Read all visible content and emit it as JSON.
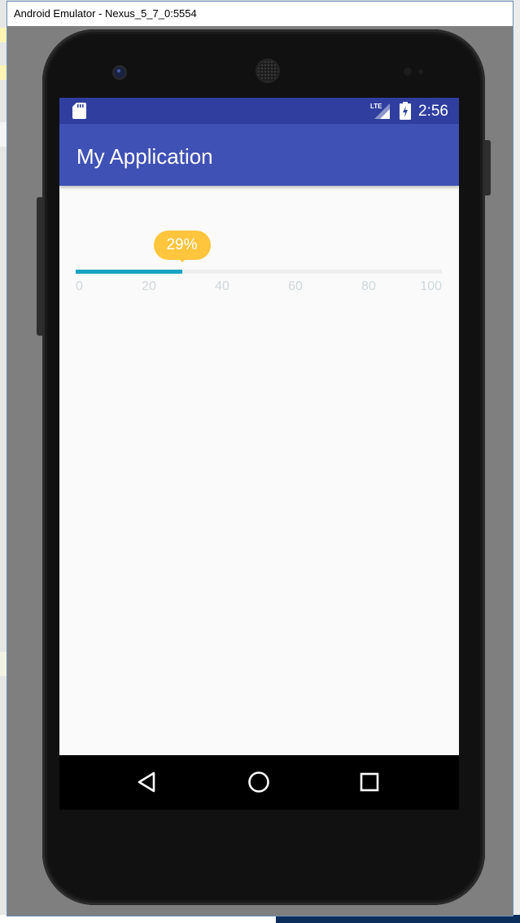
{
  "window": {
    "title": "Android Emulator - Nexus_5_7_0:5554"
  },
  "status_bar": {
    "time": "2:56",
    "network_label": "LTE",
    "icons": [
      "sd-card-icon",
      "lte-signal-icon",
      "battery-charging-icon"
    ]
  },
  "app_bar": {
    "title": "My Application"
  },
  "seekbar": {
    "progress": 29,
    "min": 0,
    "max": 100,
    "bubble_label": "29%",
    "tick_labels": [
      "0",
      "20",
      "40",
      "60",
      "80",
      "100"
    ],
    "colors": {
      "track": "#eeeeee",
      "progress": "#1aa4c2",
      "bubble": "#ffc53d",
      "tick_text": "#cfd8dc"
    }
  },
  "nav_bar": {
    "icons": [
      "back-icon",
      "home-icon",
      "recents-icon"
    ]
  },
  "colors": {
    "status_bar": "#303f9f",
    "app_bar": "#3f51b5",
    "screen_background": "#fafafa"
  }
}
